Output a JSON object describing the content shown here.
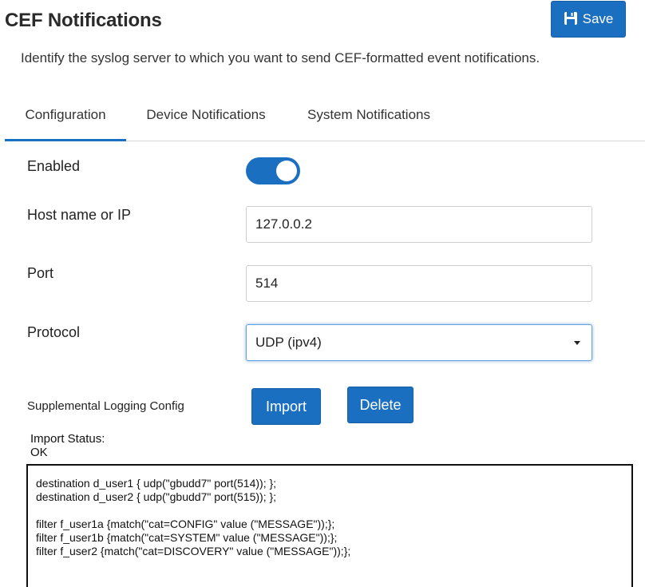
{
  "header": {
    "title": "CEF Notifications",
    "save_label": "Save",
    "description": "Identify the syslog server to which you want to send CEF-formatted event notifications."
  },
  "tabs": [
    {
      "label": "Configuration",
      "active": true
    },
    {
      "label": "Device Notifications",
      "active": false
    },
    {
      "label": "System Notifications",
      "active": false
    }
  ],
  "form": {
    "enabled": {
      "label": "Enabled",
      "value": true
    },
    "host": {
      "label": "Host name or IP",
      "value": "127.0.0.2"
    },
    "port": {
      "label": "Port",
      "value": "514"
    },
    "protocol": {
      "label": "Protocol",
      "value": "UDP (ipv4)"
    }
  },
  "supplemental": {
    "label": "Supplemental Logging Config",
    "import_label": "Import",
    "delete_label": "Delete",
    "status_label": "Import Status:",
    "status_value": "OK",
    "config_lines": [
      "destination d_user1 { udp(\"gbudd7\" port(514)); };",
      "destination d_user2 { udp(\"gbudd7\" port(515)); };",
      "",
      "filter f_user1a {match(\"cat=CONFIG\" value (\"MESSAGE\"));};",
      "filter f_user1b {match(\"cat=SYSTEM\" value (\"MESSAGE\"));};",
      "filter f_user2 {match(\"cat=DISCOVERY\" value (\"MESSAGE\"));};"
    ]
  },
  "icons": {
    "save": "floppy-disk-icon",
    "dropdown": "caret-down-icon"
  },
  "colors": {
    "accent": "#1a6fc0",
    "text": "#222222"
  }
}
